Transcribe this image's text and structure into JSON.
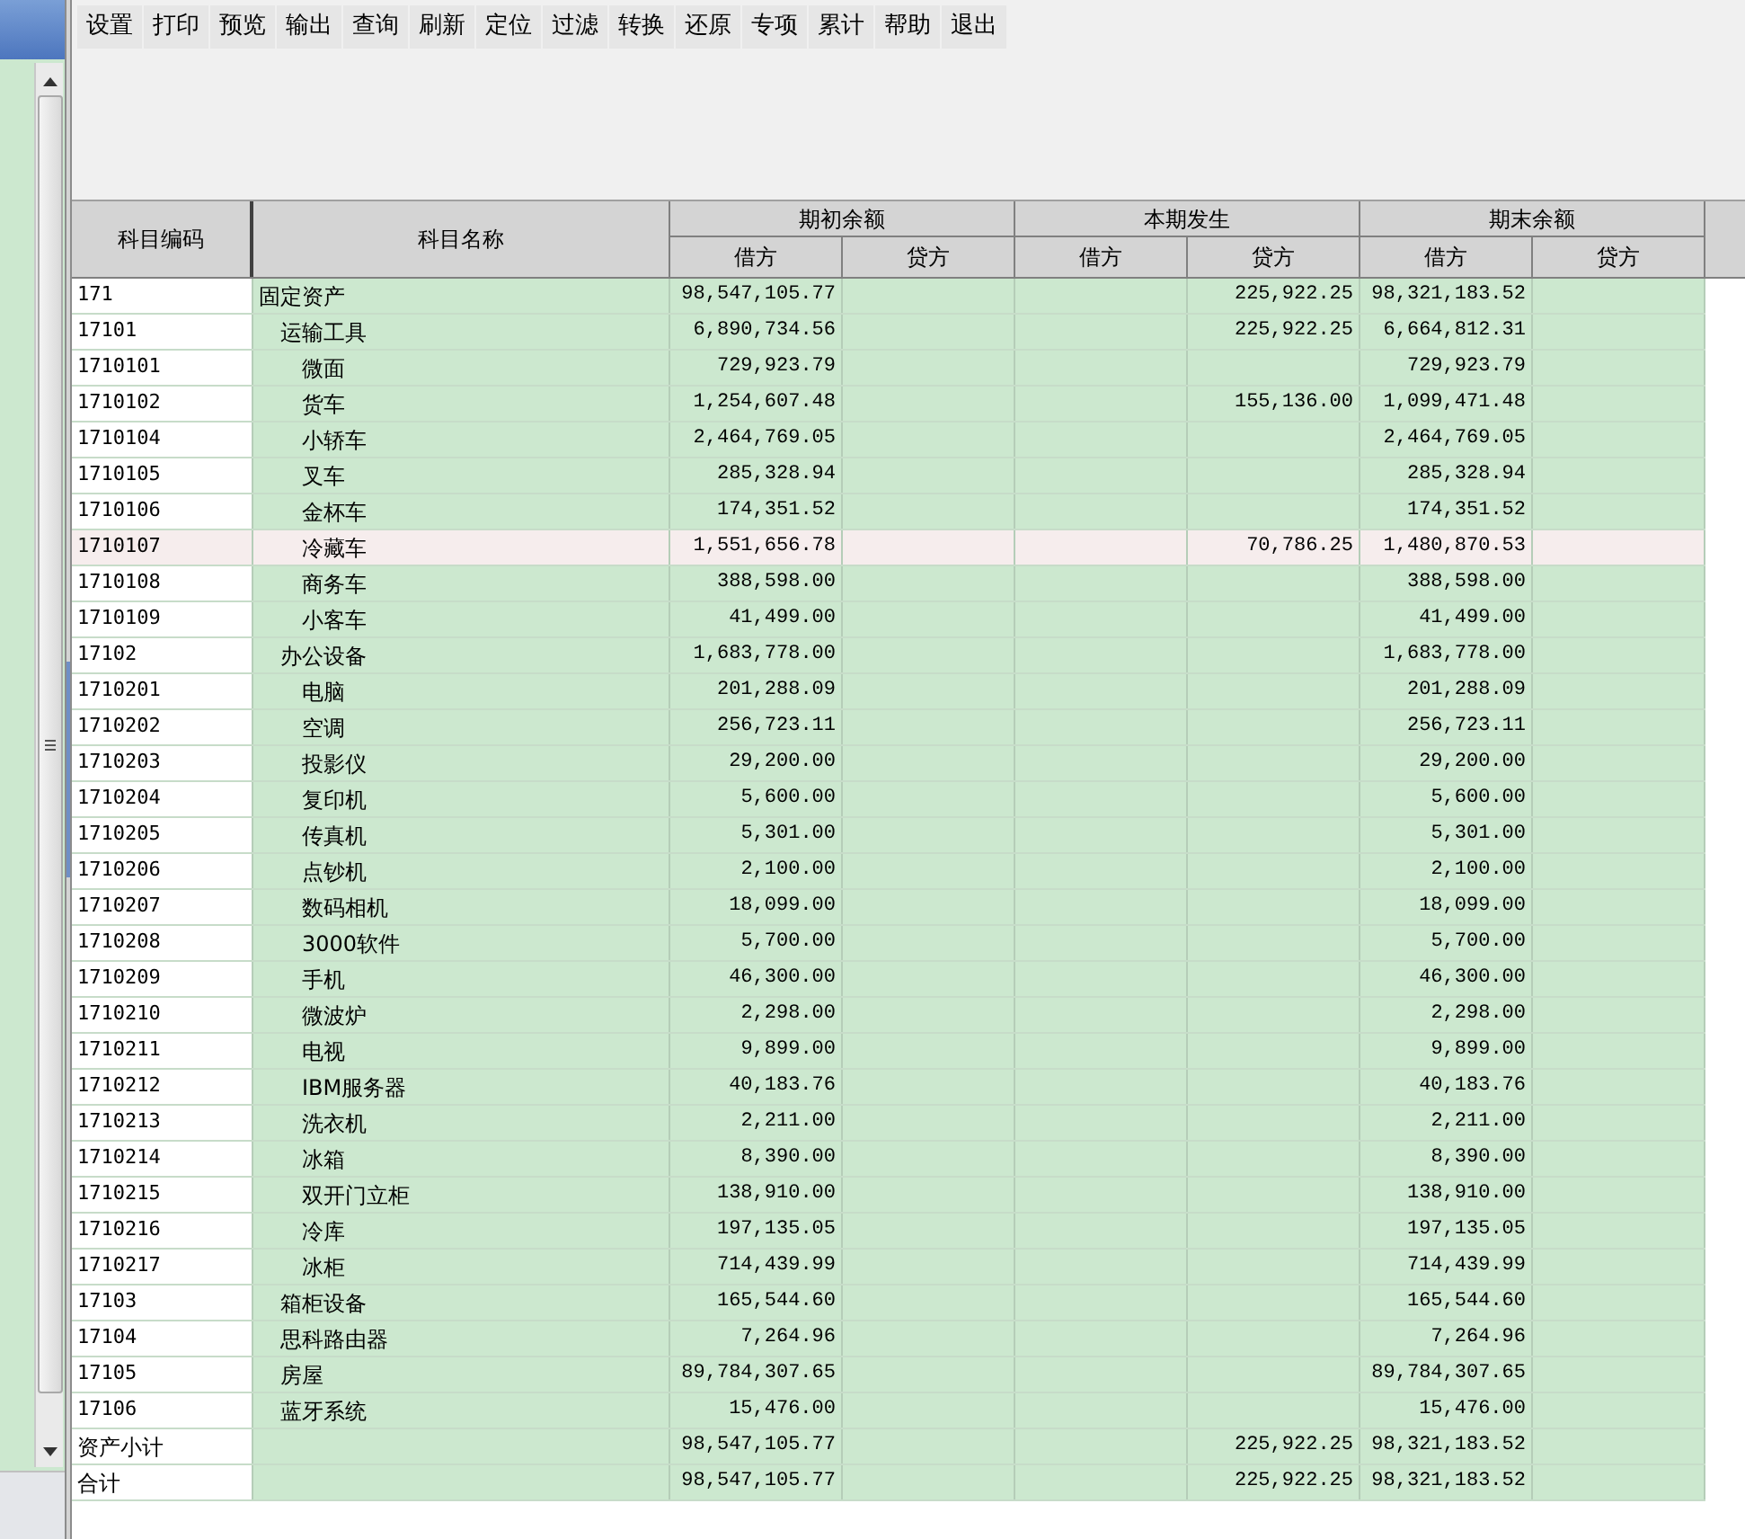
{
  "toolbar": [
    "设置",
    "打印",
    "预览",
    "输出",
    "查询",
    "刷新",
    "定位",
    "过滤",
    "转换",
    "还原",
    "专项",
    "累计",
    "帮助",
    "退出"
  ],
  "table": {
    "columns": [
      {
        "label": "科目编码"
      },
      {
        "label": "科目名称"
      },
      {
        "label": "期初余额",
        "sub": [
          "借方",
          "贷方"
        ]
      },
      {
        "label": "本期发生",
        "sub": [
          "借方",
          "贷方"
        ]
      },
      {
        "label": "期末余额",
        "sub": [
          "借方",
          "贷方"
        ]
      }
    ],
    "rows": [
      {
        "code": "171",
        "name": "固定资产",
        "values": {
          "opening_debit": "98,547,105.77",
          "period_credit": "225,922.25",
          "closing_debit": "98,321,183.52"
        },
        "selected": false,
        "children": [
          {
            "code": "17101",
            "name": "运输工具",
            "values": {
              "opening_debit": "6,890,734.56",
              "period_credit": "225,922.25",
              "closing_debit": "6,664,812.31"
            },
            "selected": false,
            "children": [
              {
                "code": "1710101",
                "name": "微面",
                "values": {
                  "opening_debit": "729,923.79",
                  "closing_debit": "729,923.79"
                },
                "selected": false
              },
              {
                "code": "1710102",
                "name": "货车",
                "values": {
                  "opening_debit": "1,254,607.48",
                  "period_credit": "155,136.00",
                  "closing_debit": "1,099,471.48"
                },
                "selected": false
              },
              {
                "code": "1710104",
                "name": "小轿车",
                "values": {
                  "opening_debit": "2,464,769.05",
                  "closing_debit": "2,464,769.05"
                },
                "selected": false
              },
              {
                "code": "1710105",
                "name": "叉车",
                "values": {
                  "opening_debit": "285,328.94",
                  "closing_debit": "285,328.94"
                },
                "selected": false
              },
              {
                "code": "1710106",
                "name": "金杯车",
                "values": {
                  "opening_debit": "174,351.52",
                  "closing_debit": "174,351.52"
                },
                "selected": false
              },
              {
                "code": "1710107",
                "name": "冷藏车",
                "values": {
                  "opening_debit": "1,551,656.78",
                  "period_credit": "70,786.25",
                  "closing_debit": "1,480,870.53"
                },
                "selected": true
              },
              {
                "code": "1710108",
                "name": "商务车",
                "values": {
                  "opening_debit": "388,598.00",
                  "closing_debit": "388,598.00"
                },
                "selected": false
              },
              {
                "code": "1710109",
                "name": "小客车",
                "values": {
                  "opening_debit": "41,499.00",
                  "closing_debit": "41,499.00"
                },
                "selected": false
              }
            ]
          },
          {
            "code": "17102",
            "name": "办公设备",
            "values": {
              "opening_debit": "1,683,778.00",
              "closing_debit": "1,683,778.00"
            },
            "selected": false,
            "children": [
              {
                "code": "1710201",
                "name": "电脑",
                "values": {
                  "opening_debit": "201,288.09",
                  "closing_debit": "201,288.09"
                },
                "selected": false
              },
              {
                "code": "1710202",
                "name": "空调",
                "values": {
                  "opening_debit": "256,723.11",
                  "closing_debit": "256,723.11"
                },
                "selected": false
              },
              {
                "code": "1710203",
                "name": "投影仪",
                "values": {
                  "opening_debit": "29,200.00",
                  "closing_debit": "29,200.00"
                },
                "selected": false
              },
              {
                "code": "1710204",
                "name": "复印机",
                "values": {
                  "opening_debit": "5,600.00",
                  "closing_debit": "5,600.00"
                },
                "selected": false
              },
              {
                "code": "1710205",
                "name": "传真机",
                "values": {
                  "opening_debit": "5,301.00",
                  "closing_debit": "5,301.00"
                },
                "selected": false
              },
              {
                "code": "1710206",
                "name": "点钞机",
                "values": {
                  "opening_debit": "2,100.00",
                  "closing_debit": "2,100.00"
                },
                "selected": false
              },
              {
                "code": "1710207",
                "name": "数码相机",
                "values": {
                  "opening_debit": "18,099.00",
                  "closing_debit": "18,099.00"
                },
                "selected": false
              },
              {
                "code": "1710208",
                "name": "3000软件",
                "values": {
                  "opening_debit": "5,700.00",
                  "closing_debit": "5,700.00"
                },
                "selected": false
              },
              {
                "code": "1710209",
                "name": "手机",
                "values": {
                  "opening_debit": "46,300.00",
                  "closing_debit": "46,300.00"
                },
                "selected": false
              },
              {
                "code": "1710210",
                "name": "微波炉",
                "values": {
                  "opening_debit": "2,298.00",
                  "closing_debit": "2,298.00"
                },
                "selected": false
              },
              {
                "code": "1710211",
                "name": "电视",
                "values": {
                  "opening_debit": "9,899.00",
                  "closing_debit": "9,899.00"
                },
                "selected": false
              },
              {
                "code": "1710212",
                "name": "IBM服务器",
                "values": {
                  "opening_debit": "40,183.76",
                  "closing_debit": "40,183.76"
                },
                "selected": false
              },
              {
                "code": "1710213",
                "name": "洗衣机",
                "values": {
                  "opening_debit": "2,211.00",
                  "closing_debit": "2,211.00"
                },
                "selected": false
              },
              {
                "code": "1710214",
                "name": "冰箱",
                "values": {
                  "opening_debit": "8,390.00",
                  "closing_debit": "8,390.00"
                },
                "selected": false
              },
              {
                "code": "1710215",
                "name": "双开门立柜",
                "values": {
                  "opening_debit": "138,910.00",
                  "closing_debit": "138,910.00"
                },
                "selected": false
              },
              {
                "code": "1710216",
                "name": "冷库",
                "values": {
                  "opening_debit": "197,135.05",
                  "closing_debit": "197,135.05"
                },
                "selected": false
              },
              {
                "code": "1710217",
                "name": "冰柜",
                "values": {
                  "opening_debit": "714,439.99",
                  "closing_debit": "714,439.99"
                },
                "selected": false
              }
            ]
          },
          {
            "code": "17103",
            "name": "箱柜设备",
            "values": {
              "opening_debit": "165,544.60",
              "closing_debit": "165,544.60"
            },
            "selected": false
          },
          {
            "code": "17104",
            "name": "思科路由器",
            "values": {
              "opening_debit": "7,264.96",
              "closing_debit": "7,264.96"
            },
            "selected": false
          },
          {
            "code": "17105",
            "name": "房屋",
            "values": {
              "opening_debit": "89,784,307.65",
              "closing_debit": "89,784,307.65"
            },
            "selected": false
          },
          {
            "code": "17106",
            "name": "蓝牙系统",
            "values": {
              "opening_debit": "15,476.00",
              "closing_debit": "15,476.00"
            },
            "selected": false
          }
        ]
      }
    ],
    "totals": [
      {
        "label": "资产小计",
        "values": {
          "opening_debit": "98,547,105.77",
          "period_credit": "225,922.25",
          "closing_debit": "98,321,183.52"
        },
        "selected": false
      },
      {
        "label": "合计",
        "values": {
          "opening_debit": "98,547,105.77",
          "period_credit": "225,922.25",
          "closing_debit": "98,321,183.52"
        },
        "selected": false
      }
    ]
  }
}
